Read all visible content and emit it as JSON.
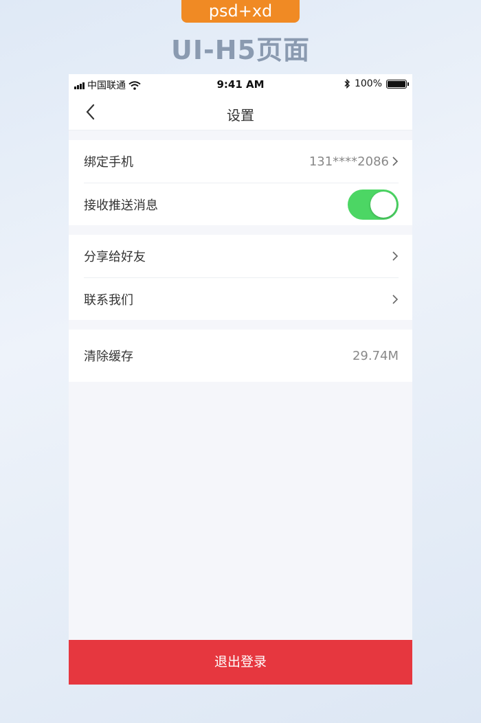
{
  "banner": {
    "tag": "psd+xd",
    "headline": "UI-H5页面"
  },
  "status_bar": {
    "carrier": "中国联通",
    "time": "9:41 AM",
    "battery": "100%"
  },
  "nav": {
    "title": "设置",
    "back_icon": "chevron-left-icon"
  },
  "settings": {
    "bind_phone": {
      "label": "绑定手机",
      "value": "131****2086"
    },
    "push": {
      "label": "接收推送消息",
      "enabled": true
    },
    "share": {
      "label": "分享给好友"
    },
    "contact": {
      "label": "联系我们"
    },
    "cache": {
      "label": "清除缓存",
      "value": "29.74M"
    }
  },
  "logout": {
    "label": "退出登录"
  },
  "colors": {
    "accent_orange": "#f08a24",
    "toggle_on": "#4cd664",
    "logout_red": "#e6373f",
    "page_bg": "#f5f6fa"
  }
}
